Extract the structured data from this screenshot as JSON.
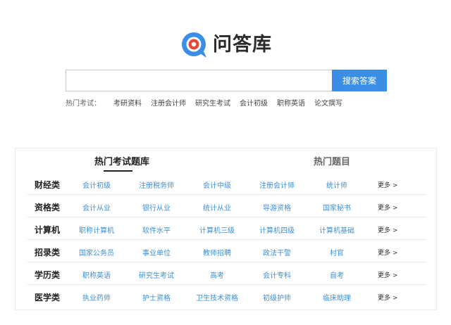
{
  "logo": {
    "text": "问答库",
    "icon": "q-bubble-logo-icon"
  },
  "search": {
    "placeholder": "",
    "button_label": "搜索答案"
  },
  "hot_exams": {
    "label": "热门考试：",
    "links": [
      "考研资料",
      "注册会计师",
      "研究生考试",
      "会计初级",
      "职称英语",
      "论文撰写"
    ]
  },
  "tabs": {
    "active": "热门考试题库",
    "inactive": "热门题目"
  },
  "more_label": "更多 >",
  "categories": [
    {
      "name": "财经类",
      "items": [
        "会计初级",
        "注册税务师",
        "会计中级",
        "注册会计师",
        "统计师"
      ]
    },
    {
      "name": "资格类",
      "items": [
        "会计从业",
        "银行从业",
        "统计从业",
        "导游资格",
        "国家秘书"
      ]
    },
    {
      "name": "计算机",
      "items": [
        "职称计算机",
        "软件水平",
        "计算机三级",
        "计算机四级",
        "计算机基础"
      ]
    },
    {
      "name": "招录类",
      "items": [
        "国家公务员",
        "事业单位",
        "教师招聘",
        "政法干警",
        "村官"
      ]
    },
    {
      "name": "学历类",
      "items": [
        "职称英语",
        "研究生考试",
        "高考",
        "会计专科",
        "自考"
      ]
    },
    {
      "name": "医学类",
      "items": [
        "执业药师",
        "护士资格",
        "卫生技术资格",
        "初级护师",
        "临床助理"
      ]
    }
  ],
  "colors": {
    "accent": "#3a8ee6",
    "link": "#3d8fd6",
    "logo_red": "#e8483b",
    "logo_blue": "#3a8ee6"
  }
}
